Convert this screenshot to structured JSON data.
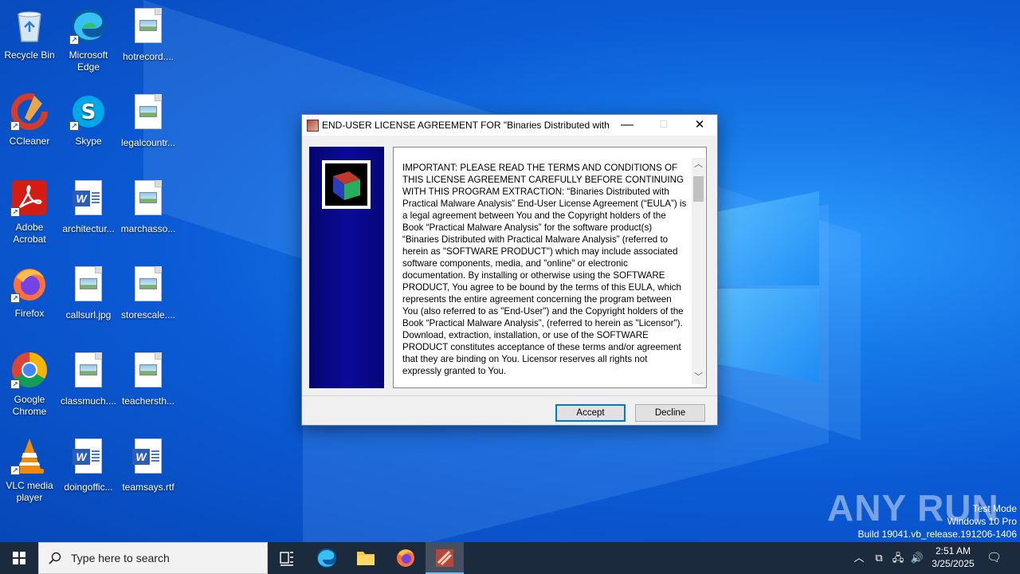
{
  "desktop": {
    "icons": [
      {
        "label": "Recycle Bin",
        "kind": "recycle-bin"
      },
      {
        "label": "Microsoft Edge",
        "kind": "edge"
      },
      {
        "label": "hotrecord....",
        "kind": "image-file"
      },
      {
        "label": "CCleaner",
        "kind": "ccleaner"
      },
      {
        "label": "Skype",
        "kind": "skype"
      },
      {
        "label": "legalcountr...",
        "kind": "image-file"
      },
      {
        "label": "Adobe Acrobat",
        "kind": "acrobat"
      },
      {
        "label": "architectur...",
        "kind": "word-file"
      },
      {
        "label": "marchasso...",
        "kind": "image-file"
      },
      {
        "label": "Firefox",
        "kind": "firefox"
      },
      {
        "label": "callsurl.jpg",
        "kind": "image-file"
      },
      {
        "label": "storescale....",
        "kind": "image-file"
      },
      {
        "label": "Google Chrome",
        "kind": "chrome"
      },
      {
        "label": "classmuch....",
        "kind": "image-file"
      },
      {
        "label": "teachersth...",
        "kind": "image-file"
      },
      {
        "label": "VLC media player",
        "kind": "vlc"
      },
      {
        "label": "doingoffic...",
        "kind": "word-file"
      },
      {
        "label": "teamsays.rtf",
        "kind": "word-file"
      }
    ]
  },
  "dialog": {
    "title": "END-USER LICENSE AGREEMENT FOR \"Binaries Distributed with Pr...",
    "eula_text": "IMPORTANT: PLEASE READ THE TERMS AND CONDITIONS OF THIS LICENSE AGREEMENT CAREFULLY BEFORE CONTINUING WITH THIS PROGRAM EXTRACTION: “Binaries Distributed with Practical Malware Analysis” End-User License Agreement (“EULA”) is a legal agreement between You and the Copyright holders of the Book “Practical Malware Analysis” for the software product(s) “Binaries Distributed with Practical Malware Analysis” (referred to herein as \"SOFTWARE PRODUCT\") which may include associated software components, media, and \"online\" or electronic documentation. By installing or otherwise using the SOFTWARE PRODUCT, You agree to be bound by the terms of this EULA, which represents the entire agreement concerning the program between You (also referred to as \"End-User\") and the Copyright holders of the Book “Practical Malware Analysis”, (referred to herein as \"Licensor\"). Download, extraction, installation, or use of the SOFTWARE PRODUCT constitutes acceptance of these terms and/or agreement that they are binding on You. Licensor reserves all rights not expressly granted to You.",
    "accept_label": "Accept",
    "decline_label": "Decline",
    "minimize_glyph": "—",
    "maximize_glyph": "☐",
    "close_glyph": "✕"
  },
  "watermark": {
    "brand": "ANY RUN",
    "line1": "Test Mode",
    "line2": "Windows 10 Pro",
    "line3": "Build 19041.vb_release.191206-1406"
  },
  "taskbar": {
    "search_placeholder": "Type here to search",
    "time": "2:51 AM",
    "date": "3/25/2025",
    "items": [
      "task-view",
      "edge",
      "file-explorer",
      "firefox",
      "extractor-app"
    ]
  }
}
